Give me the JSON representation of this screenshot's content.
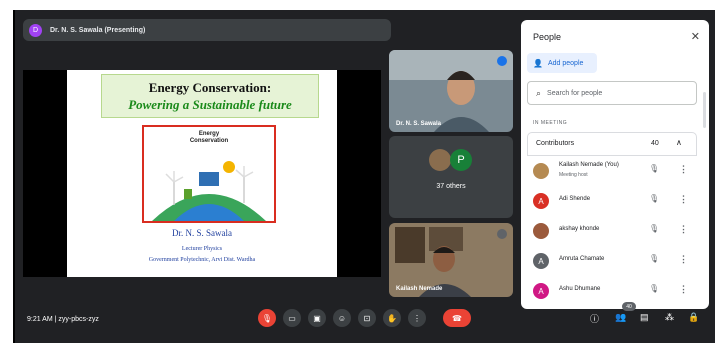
{
  "presenter": {
    "initial": "D",
    "label": "Dr. N. S. Sawala (Presenting)"
  },
  "slide": {
    "title_line1": "Energy Conservation:",
    "title_line2": "Powering  a Sustainable future",
    "image_title": "Energy\nConservation",
    "name": "Dr.  N. S. Sawala",
    "designation": "Lecturer Physics",
    "institute": "Government Polytechnic, Arvi Dist. Wardha"
  },
  "tiles": {
    "presenter_name": "Dr. N. S. Sawala",
    "others_initial": "P",
    "others_label": "37 others",
    "self_name": "Kailash Nemade"
  },
  "people_panel": {
    "title": "People",
    "close_icon": "close-icon",
    "add_people": "Add people",
    "search_placeholder": "Search for people",
    "section": "IN MEETING",
    "contributors_label": "Contributors",
    "contributors_count": "40",
    "members": [
      {
        "name": "Kailash Nemade (You)",
        "sub": "Meeting host",
        "initial": "",
        "color": "#b58a52"
      },
      {
        "name": "Adi Shende",
        "sub": "",
        "initial": "A",
        "color": "#d93025"
      },
      {
        "name": "akshay khonde",
        "sub": "",
        "initial": "",
        "color": "#9b5a3c"
      },
      {
        "name": "Amruta Chamate",
        "sub": "",
        "initial": "A",
        "color": "#5f6368"
      },
      {
        "name": "Ashu Dhumane",
        "sub": "",
        "initial": "A",
        "color": "#d01884"
      }
    ]
  },
  "bottom_bar": {
    "time_code": "9:21 AM  |  zyy-pbcs-zyz",
    "participant_count": "40"
  },
  "colors": {
    "background": "#202124",
    "tile": "#3c4043",
    "accent": "#1a73e8",
    "danger": "#ea4335"
  }
}
